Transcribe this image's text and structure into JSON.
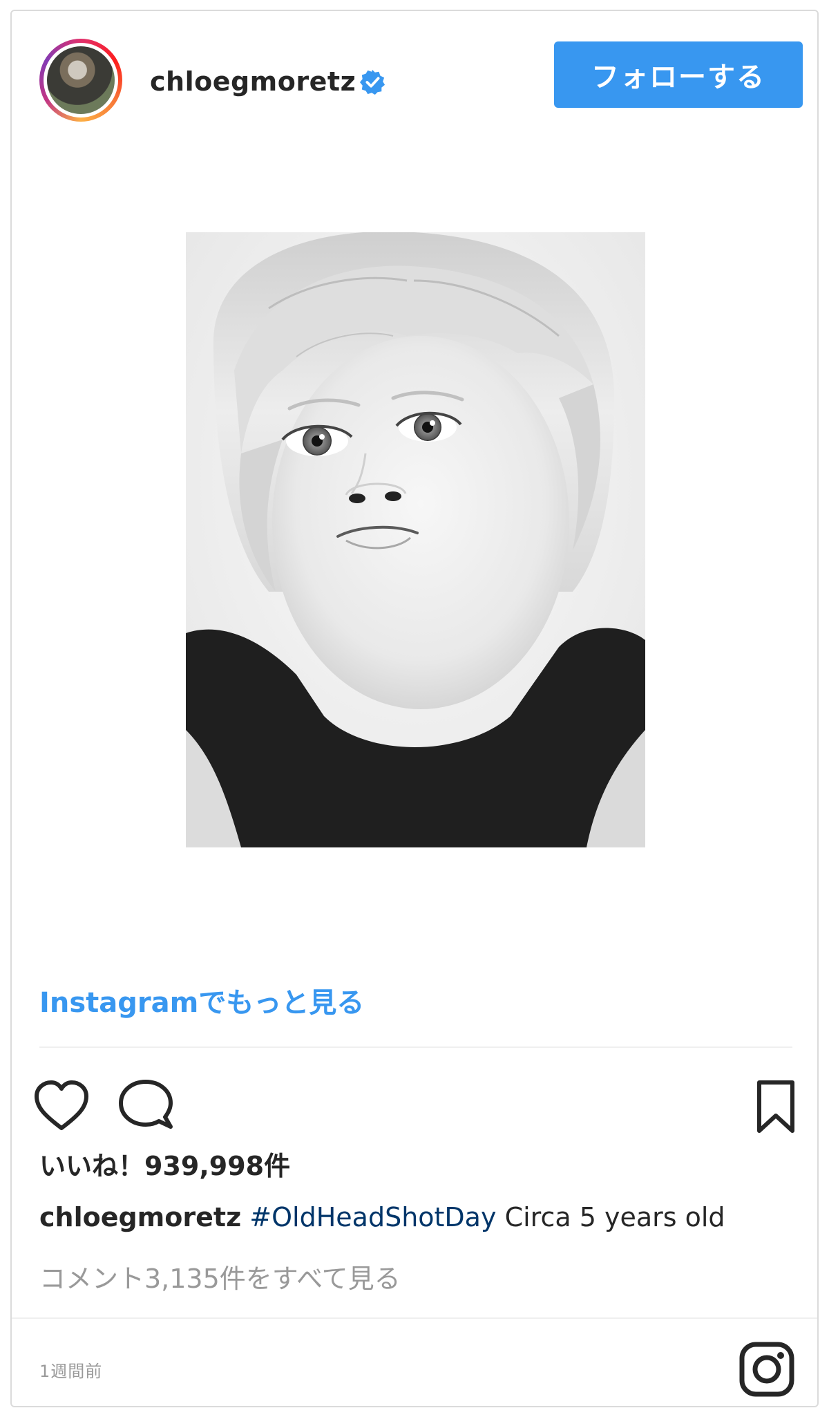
{
  "header": {
    "username": "chloegmoretz",
    "verified": true,
    "follow_label": "フォローする"
  },
  "post": {
    "image_alt": "Black-and-white headshot of a young child with light blonde hair",
    "more_link": "Instagramでもっと見る"
  },
  "actions": {
    "like_icon": "heart-icon",
    "comment_icon": "comment-icon",
    "save_icon": "bookmark-icon"
  },
  "stats": {
    "likes": "いいね！939,998件"
  },
  "caption": {
    "username": "chloegmoretz",
    "hashtag": "#OldHeadShotDay",
    "text": "Circa 5 years old"
  },
  "comments": {
    "view_all": "コメント3,135件をすべて見る"
  },
  "footer": {
    "timestamp": "1週間前",
    "logo_icon": "instagram-logo-icon"
  },
  "colors": {
    "accent": "#3897f0",
    "text": "#262626",
    "muted": "#999999",
    "border": "#dbdbdb"
  }
}
